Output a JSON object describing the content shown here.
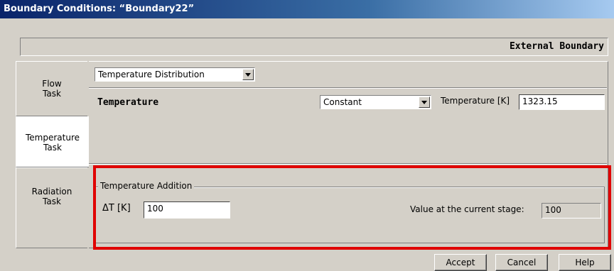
{
  "window": {
    "title": "Boundary Conditions: “Boundary22”"
  },
  "header": {
    "boundary_type": "External Boundary"
  },
  "tabs": [
    {
      "label_line1": "Flow",
      "label_line2": "Task"
    },
    {
      "label_line1": "Temperature",
      "label_line2": "Task"
    },
    {
      "label_line1": "Radiation",
      "label_line2": "Task"
    }
  ],
  "panel": {
    "category_select": "Temperature Distribution",
    "temperature_label": "Temperature",
    "mode_select": "Constant",
    "temperature_field_label": "Temperature [K]",
    "temperature_value": "1323.15"
  },
  "addition": {
    "group_title": "Temperature Addition",
    "delta_label": "ΔT [K]",
    "delta_value": "100",
    "current_label": "Value at the current stage:",
    "current_value": "100"
  },
  "buttons": {
    "accept": "Accept",
    "cancel": "Cancel",
    "help": "Help"
  },
  "colors": {
    "highlight": "#e00000",
    "titlebar": "#0a246a"
  }
}
